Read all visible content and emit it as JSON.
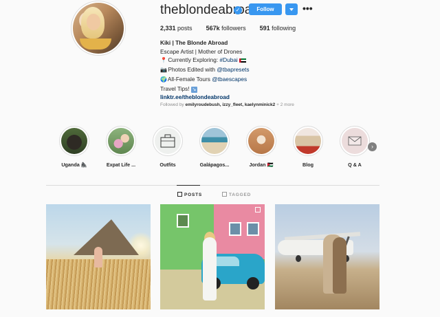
{
  "profile": {
    "username": "theblondeabroad",
    "follow_label": "Follow",
    "stats": {
      "posts_count": "2,331",
      "posts_label": "posts",
      "followers_count": "567k",
      "followers_label": "followers",
      "following_count": "591",
      "following_label": "following"
    },
    "bio": {
      "name": "Kiki | The Blonde Abroad",
      "line1": "Escape Artist | Mother of Drones",
      "line2_prefix": "Currently Exploring: ",
      "line2_tag": "#Dubai",
      "line3_prefix": "Photos Edited with ",
      "line3_handle": "@tbapresets",
      "line4_prefix": "All-Female Tours ",
      "line4_handle": "@tbaescapes",
      "line5": "Travel Tips! ",
      "url": "linktr.ee/theblondeabroad"
    },
    "followed_by": {
      "prefix": "Followed by ",
      "users": "emilyroudebush, izzy_fleet, kaelynminick2",
      "suffix": " + 2 more"
    }
  },
  "highlights": [
    {
      "label": "Uganda 🦍"
    },
    {
      "label": "Expat Life ..."
    },
    {
      "label": "Outfits"
    },
    {
      "label": "Galápagos..."
    },
    {
      "label": "Jordan 🇯🇴"
    },
    {
      "label": "Blog"
    },
    {
      "label": "Q & A"
    }
  ],
  "tabs": {
    "posts": "POSTS",
    "tagged": "TAGGED"
  },
  "colors": {
    "accent": "#3897f0",
    "link": "#003569",
    "muted": "#8e8e8e",
    "divider": "#dbdbdb"
  },
  "icons": [
    "verified-badge-icon",
    "chevron-down-icon",
    "more-options-icon",
    "pin-icon",
    "camera-icon",
    "globe-icon",
    "right-arrow-icon",
    "grid-icon",
    "tag-icon",
    "multiple-photos-icon"
  ]
}
